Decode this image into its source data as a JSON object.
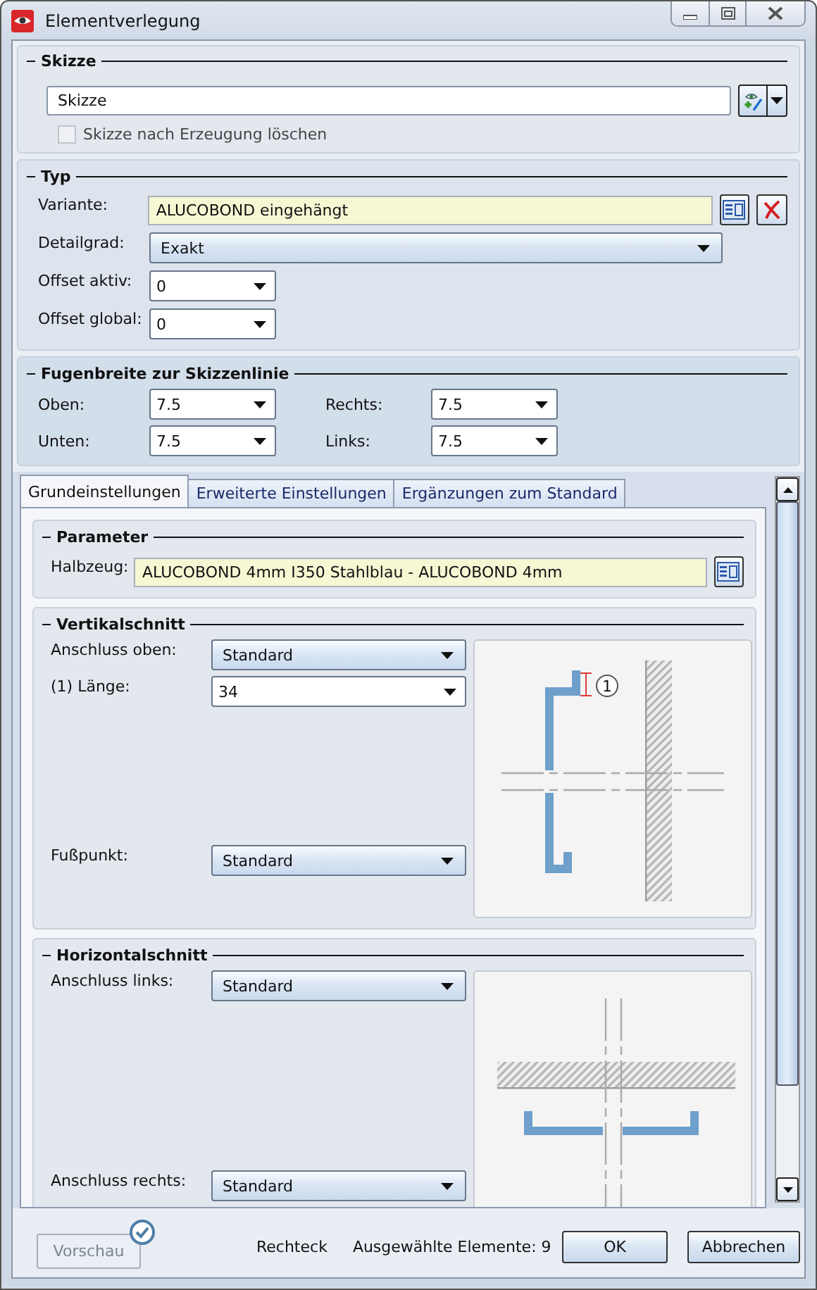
{
  "window": {
    "title": "Elementverlegung"
  },
  "skizze": {
    "heading": "Skizze",
    "field": {
      "value": "Skizze"
    },
    "checkbox": {
      "label": "Skizze nach Erzeugung löschen",
      "checked": false,
      "disabled": true
    }
  },
  "typ": {
    "heading": "Typ",
    "rows": [
      {
        "kind": "picker",
        "label": "Variante:",
        "value": "ALUCOBOND eingehängt"
      },
      {
        "kind": "dropdown",
        "label": "Detailgrad:",
        "value": "Exakt"
      },
      {
        "kind": "combo",
        "label": "Offset aktiv:",
        "value": "0"
      },
      {
        "kind": "combo",
        "label": "Offset global:",
        "value": "0"
      }
    ]
  },
  "fugenbreite": {
    "heading": "Fugenbreite zur Skizzenlinie",
    "fields": [
      {
        "label": "Oben:",
        "value": "7.5"
      },
      {
        "label": "Rechts:",
        "value": "7.5"
      },
      {
        "label": "Unten:",
        "value": "7.5"
      },
      {
        "label": "Links:",
        "value": "7.5"
      }
    ]
  },
  "tabs": [
    {
      "label": "Grundeinstellungen",
      "selected": true
    },
    {
      "label": "Erweiterte Einstellungen",
      "selected": false
    },
    {
      "label": "Ergänzungen zum Standard",
      "selected": false
    }
  ],
  "parameter": {
    "heading": "Parameter",
    "label": "Halbzeug:",
    "value": "ALUCOBOND 4mm I350 Stahlblau - ALUCOBOND 4mm"
  },
  "vertikalschnitt": {
    "heading": "Vertikalschnitt",
    "callout": "1",
    "rows": [
      {
        "kind": "dropdown",
        "label": "Anschluss oben:",
        "value": "Standard"
      },
      {
        "kind": "combo",
        "label": "(1) Länge:",
        "value": "34"
      },
      {
        "kind": "dropdown",
        "label": "Fußpunkt:",
        "value": "Standard"
      }
    ]
  },
  "horizontalschnitt": {
    "heading": "Horizontalschnitt",
    "rows": [
      {
        "kind": "dropdown",
        "label": "Anschluss links:",
        "value": "Standard"
      },
      {
        "kind": "dropdown",
        "label": "Anschluss rechts:",
        "value": "Standard"
      }
    ]
  },
  "footer": {
    "preview": {
      "label": "Vorschau",
      "disabled": true
    },
    "shape": "Rechteck",
    "selection": "Ausgewählte Elemente: 9",
    "buttons": [
      "OK",
      "Abbrechen"
    ]
  }
}
